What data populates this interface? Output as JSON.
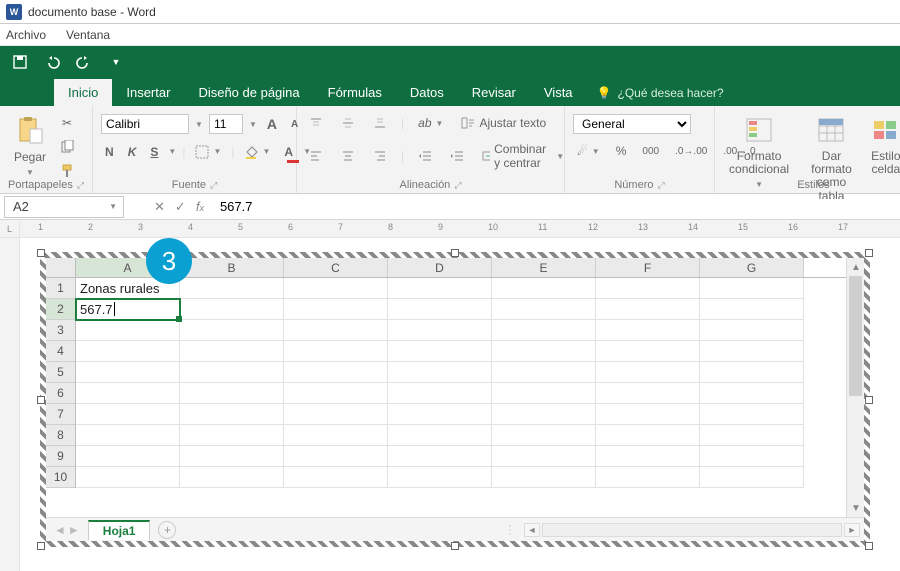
{
  "titlebar": {
    "title": "documento base - Word"
  },
  "menubar": {
    "items": [
      "Archivo",
      "Ventana"
    ]
  },
  "tabs": {
    "items": [
      "Inicio",
      "Insertar",
      "Diseño de página",
      "Fórmulas",
      "Datos",
      "Revisar",
      "Vista"
    ],
    "active_index": 0,
    "tell_me": "¿Qué desea hacer?"
  },
  "ribbon": {
    "clipboard": {
      "paste": "Pegar",
      "group_label": "Portapapeles"
    },
    "font": {
      "name": "Calibri",
      "size": "11",
      "increase": "A",
      "decrease": "A",
      "bold": "N",
      "italic": "K",
      "underline": "S",
      "group_label": "Fuente"
    },
    "alignment": {
      "wrap": "Ajustar texto",
      "merge": "Combinar y centrar",
      "group_label": "Alineación"
    },
    "number": {
      "format": "General",
      "group_label": "Número"
    },
    "styles": {
      "cond": "Formato condicional",
      "table": "Dar formato como tabla",
      "cell": "Estilo celda",
      "group_label": "Estilos"
    }
  },
  "formula_bar": {
    "name_box": "A2",
    "fx_value": "567.7"
  },
  "ruler": {
    "marks": [
      1,
      2,
      3,
      4,
      5,
      6,
      7,
      8,
      9,
      10,
      11,
      12,
      13,
      14,
      15,
      16,
      17
    ]
  },
  "badge": "3",
  "sheet": {
    "columns": [
      "A",
      "B",
      "C",
      "D",
      "E",
      "F",
      "G"
    ],
    "selected_col_index": 0,
    "row_count": 10,
    "selected_row": 2,
    "cells": {
      "A1": "Zonas rurales",
      "A2": "567.7"
    },
    "active_cell": "A2",
    "tab_name": "Hoja1"
  }
}
